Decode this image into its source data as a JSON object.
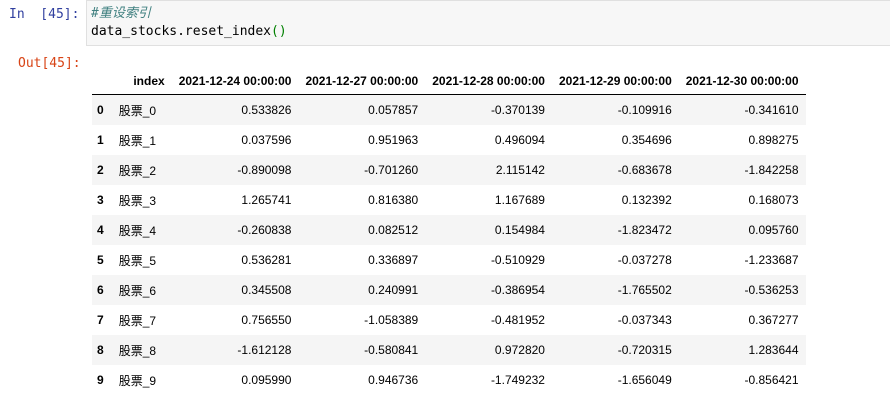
{
  "input_prompt": "In  [45]:",
  "output_prompt": "Out[45]:",
  "code": {
    "comment": "#重设索引",
    "statement": "data_stocks.reset_index",
    "call_parens": "()"
  },
  "table": {
    "blank_header": "",
    "index_header": "index",
    "columns": [
      "2021-12-24 00:00:00",
      "2021-12-27 00:00:00",
      "2021-12-28 00:00:00",
      "2021-12-29 00:00:00",
      "2021-12-30 00:00:00"
    ],
    "rows": [
      {
        "row_label": "0",
        "index": "股票_0",
        "values": [
          "0.533826",
          "0.057857",
          "-0.370139",
          "-0.109916",
          "-0.341610"
        ]
      },
      {
        "row_label": "1",
        "index": "股票_1",
        "values": [
          "0.037596",
          "0.951963",
          "0.496094",
          "0.354696",
          "0.898275"
        ]
      },
      {
        "row_label": "2",
        "index": "股票_2",
        "values": [
          "-0.890098",
          "-0.701260",
          "2.115142",
          "-0.683678",
          "-1.842258"
        ]
      },
      {
        "row_label": "3",
        "index": "股票_3",
        "values": [
          "1.265741",
          "0.816380",
          "1.167689",
          "0.132392",
          "0.168073"
        ]
      },
      {
        "row_label": "4",
        "index": "股票_4",
        "values": [
          "-0.260838",
          "0.082512",
          "0.154984",
          "-1.823472",
          "0.095760"
        ]
      },
      {
        "row_label": "5",
        "index": "股票_5",
        "values": [
          "0.536281",
          "0.336897",
          "-0.510929",
          "-0.037278",
          "-1.233687"
        ]
      },
      {
        "row_label": "6",
        "index": "股票_6",
        "values": [
          "0.345508",
          "0.240991",
          "-0.386954",
          "-1.765502",
          "-0.536253"
        ]
      },
      {
        "row_label": "7",
        "index": "股票_7",
        "values": [
          "0.756550",
          "-1.058389",
          "-0.481952",
          "-0.037343",
          "0.367277"
        ]
      },
      {
        "row_label": "8",
        "index": "股票_8",
        "values": [
          "-1.612128",
          "-0.580841",
          "0.972820",
          "-0.720315",
          "1.283644"
        ]
      },
      {
        "row_label": "9",
        "index": "股票_9",
        "values": [
          "0.095990",
          "0.946736",
          "-1.749232",
          "-1.656049",
          "-0.856421"
        ]
      }
    ]
  }
}
